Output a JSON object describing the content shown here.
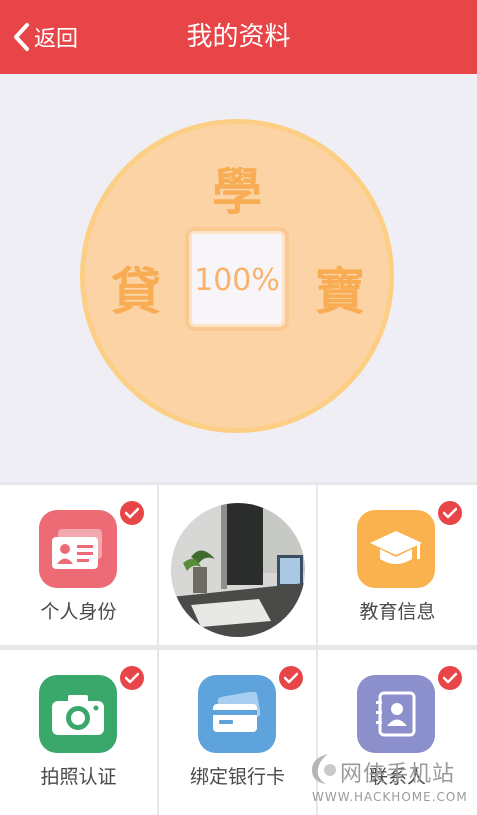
{
  "header": {
    "back_label": "返回",
    "title": "我的资料"
  },
  "hero": {
    "char_top": "學",
    "char_left": "貸",
    "char_right": "寶",
    "progress_text": "100%",
    "progress": 1.0
  },
  "items": [
    {
      "label": "个人身份",
      "icon": "id-card-icon",
      "color": "#ec6b75",
      "verified": true
    },
    {
      "label": "",
      "icon": "avatar-photo",
      "verified": false
    },
    {
      "label": "教育信息",
      "icon": "graduation-cap-icon",
      "color": "#f9b24e",
      "verified": true
    },
    {
      "label": "拍照认证",
      "icon": "camera-icon",
      "color": "#3aa86a",
      "verified": true
    },
    {
      "label": "绑定银行卡",
      "icon": "bank-card-icon",
      "color": "#5fa3dc",
      "verified": true
    },
    {
      "label": "联系人",
      "icon": "contacts-icon",
      "color": "#8b90cc",
      "verified": true
    }
  ],
  "watermark": {
    "name": "网侠手机站",
    "url": "WWW.HACKHOME.COM"
  },
  "colors": {
    "accent": "#e84549",
    "coin": "#fbd3a5",
    "coin_text": "#f8ad55"
  }
}
